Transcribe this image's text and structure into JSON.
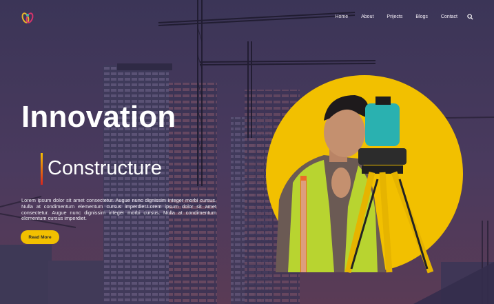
{
  "nav": {
    "logo_name": "brand-logo",
    "items": [
      "Home",
      "About",
      "Prijects",
      "Blogs",
      "Contact"
    ],
    "search_icon": "search-icon"
  },
  "hero": {
    "title": "Innovation",
    "subtitle": "Constructure",
    "description": "Lorem ipsum dolor sit amet consectetur. Augue nunc dignissim integer morbi cursus. Nulla at condimentum elementum cursus imperdiet.Lorem ipsum dolor sit amet consectetur. Augue nunc dignissim integer morbi cursus. Nulla at condimentum elementum cursus imperdiet.",
    "button_label": "Read More"
  },
  "colors": {
    "accent_yellow": "#f2c000",
    "background_purple": "#3a3353",
    "bar_gradient_end": "#d7261e"
  }
}
